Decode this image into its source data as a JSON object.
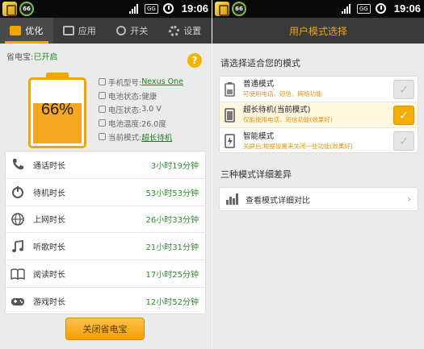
{
  "status_bar": {
    "battery_badge": "66",
    "network_badge": "GG",
    "time": "19:06"
  },
  "left": {
    "tabs": [
      {
        "label": "优化",
        "icon": "briefcase-icon",
        "active": true
      },
      {
        "label": "应用",
        "icon": "apps-icon",
        "active": false
      },
      {
        "label": "开关",
        "icon": "power-icon",
        "active": false
      },
      {
        "label": "设置",
        "icon": "gear-icon",
        "active": false
      }
    ],
    "status_prefix": "省电宝:",
    "status_value": "已开启",
    "help": "?",
    "battery_percent_text": "66%",
    "battery_level": 0.66,
    "info": [
      {
        "label": "手机型号:",
        "value": "Nexus One",
        "link": true
      },
      {
        "label": "电池状态:",
        "value": "健康",
        "link": false
      },
      {
        "label": "电压状态:",
        "value": "3.0 V",
        "link": false
      },
      {
        "label": "电池温度:",
        "value": "26.0度",
        "link": false
      },
      {
        "label": "当前模式:",
        "value": "超长待机",
        "link": true
      }
    ],
    "usage": [
      {
        "label": "通话时长",
        "value": "3小时19分钟",
        "icon": "phone-icon"
      },
      {
        "label": "待机时长",
        "value": "53小时53分钟",
        "icon": "standby-power-icon"
      },
      {
        "label": "上网时长",
        "value": "26小时33分钟",
        "icon": "globe-icon"
      },
      {
        "label": "听歌时长",
        "value": "21小时31分钟",
        "icon": "music-note-icon"
      },
      {
        "label": "阅读时长",
        "value": "17小时25分钟",
        "icon": "book-icon"
      },
      {
        "label": "游戏时长",
        "value": "12小时52分钟",
        "icon": "gamepad-icon"
      }
    ],
    "close_button": "关闭省电宝"
  },
  "right": {
    "title": "用户模式选择",
    "prompt": "请选择适合您的模式",
    "modes": [
      {
        "name": "普通模式",
        "desc": "可使用电话、短信、网络功能",
        "selected": false,
        "icon": "battery-normal-icon"
      },
      {
        "name": "超长待机(当前模式)",
        "desc": "仅能使用电话、短信功能(效果好)",
        "selected": true,
        "icon": "battery-standby-icon"
      },
      {
        "name": "智能模式",
        "desc": "关屏后,根据设置来关闭一些功能(效果好)",
        "selected": false,
        "icon": "smart-mode-icon"
      }
    ],
    "difference_title": "三种模式详细差异",
    "compare_label": "查看模式详细对比",
    "chevron": "›"
  }
}
